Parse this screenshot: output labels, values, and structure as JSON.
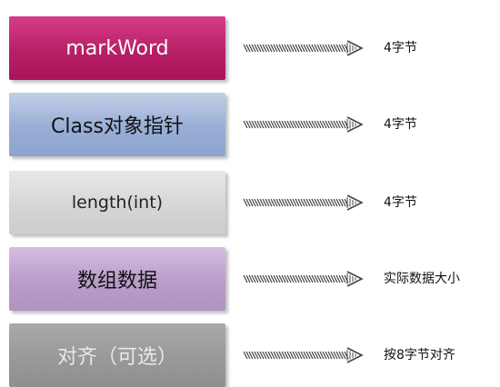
{
  "rows": [
    {
      "label": "markWord",
      "note": "4字节",
      "color": "#b81f66"
    },
    {
      "label": "Class对象指针",
      "note": "4字节",
      "color": "#98aed6"
    },
    {
      "label": "length(int)",
      "note": "4字节",
      "color": "#d6d6d6"
    },
    {
      "label": "数组数据",
      "note": "实际数据大小",
      "color": "#b99cc9"
    },
    {
      "label": "对齐（可选）",
      "note": "按8字节对齐",
      "color": "#999999"
    }
  ],
  "arrow_icon": "striped-arrow-icon"
}
